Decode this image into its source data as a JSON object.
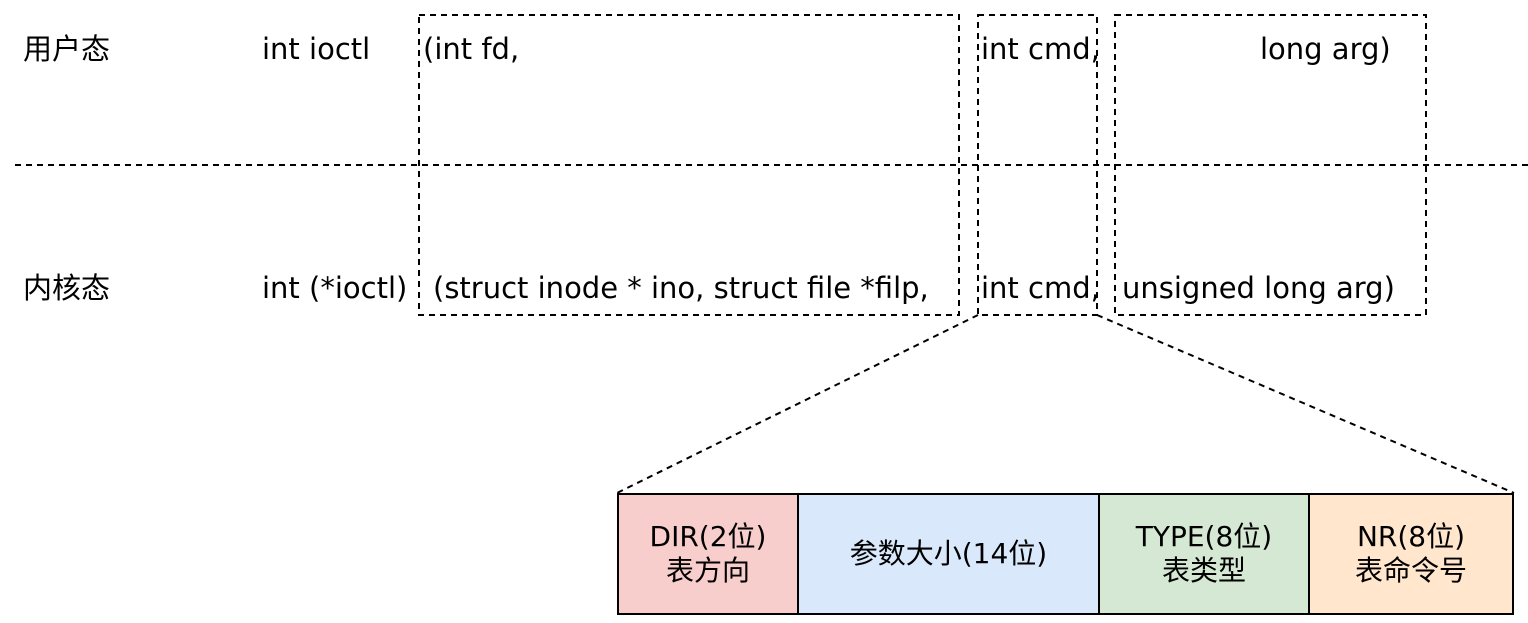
{
  "rows": {
    "user": {
      "label": "用户态",
      "ret": "int ioctl",
      "param1": "(int fd,",
      "param2": "int cmd,",
      "param3": "long arg)"
    },
    "kernel": {
      "label": "内核态",
      "ret": "int (*ioctl)",
      "param1": "(struct inode * ino, struct file *filp,",
      "param2": "int cmd,",
      "param3": "unsigned long arg)"
    }
  },
  "bitfield": [
    {
      "line1": "DIR(2位)",
      "line2": "表方向",
      "color": "#f8cecc"
    },
    {
      "line1": "参数大小(14位)",
      "line2": "",
      "color": "#dae8fc"
    },
    {
      "line1": "TYPE(8位)",
      "line2": "表类型",
      "color": "#d5e8d4"
    },
    {
      "line1": "NR(8位)",
      "line2": "表命令号",
      "color": "#ffe6cc"
    }
  ]
}
